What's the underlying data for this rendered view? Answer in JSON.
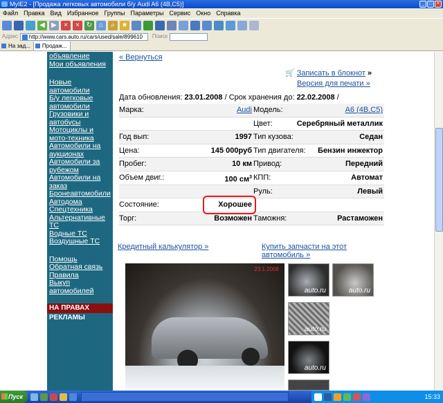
{
  "window": {
    "title": "MyIE2 - [Продажа легковых автомобили б/у Audi A6 (4B,C5)]"
  },
  "menu": [
    "Файл",
    "Правка",
    "Вид",
    "Избранное",
    "Группы",
    "Параметры",
    "Сервис",
    "Окно",
    "Справка"
  ],
  "address": {
    "label": "Адрес",
    "url": "http://www.cars.auto.ru/cars/used/sale/899610",
    "search_label": "Поиск"
  },
  "tabs": [
    "На зад...",
    "Продаж..."
  ],
  "sidebar": {
    "links": [
      "объявление",
      "Мои объявления",
      "Новые автомобили",
      "Б/у легковые автомобили",
      "Грузовики и автобусы",
      "Мотоциклы и мото-техника",
      "Автомобили на аукционах",
      "Автомобили за рубежом",
      "Автомобили на заказ",
      "Бронеавтомобили",
      "Автодома",
      "Спецтехника",
      "Альтернативные ТС",
      "Водные ТС",
      "Воздушные ТС",
      "Помощь",
      "Обратная связь",
      "Правила",
      "Выкуп автомобилей"
    ],
    "ad_label": "НА ПРАВАХ РЕКЛАМЫ"
  },
  "main": {
    "back": "« Вернуться",
    "notepad": "Записать в блокнот",
    "notepad_suffix": "»",
    "print": "Версия для печати »",
    "update_label": "Дата обновления:",
    "update_date": "23.01.2008",
    "storage_label": "/ Срок хранения до:",
    "storage_date": "22.02.2008",
    "storage_suffix": "/",
    "rows": [
      {
        "k1": "Марка:",
        "v1": "Audi",
        "k2": "Модель:",
        "v2": "A6 (4B,C5)"
      },
      {
        "k1": "",
        "v1": "",
        "k2": "Цвет:",
        "v2": "Серебряный металлик"
      },
      {
        "k1": "Год вып:",
        "v1": "1997",
        "k2": "Тип кузова:",
        "v2": "Седан"
      },
      {
        "k1": "Цена:",
        "v1": "145 000руб",
        "k2": "Тип двигателя:",
        "v2": "Бензин инжектор"
      },
      {
        "k1": "Пробег:",
        "v1": "10 км",
        "k2": "Привод:",
        "v2": "Передний"
      },
      {
        "k1": "Объем двиг.:",
        "v1": "100 см",
        "k2": "КПП:",
        "v2": "Автомат"
      },
      {
        "k1": "",
        "v1": "",
        "k2": "Руль:",
        "v2": "Левый"
      },
      {
        "k1": "Состояние:",
        "v1": "Хорошее",
        "k2": "",
        "v2": ""
      },
      {
        "k1": "Торг:",
        "v1": "Возможен",
        "k2": "Таможня:",
        "v2": "Растаможен"
      }
    ],
    "volume_unit_sup": "3",
    "calc": "Кредитный калькулятор »",
    "parts": "Купить запчасти на этот автомобиль »",
    "photo_date": "23.1.2008",
    "watermark": "auto.ru"
  },
  "taskbar": {
    "start": "Пуск",
    "clock": "15:33"
  }
}
